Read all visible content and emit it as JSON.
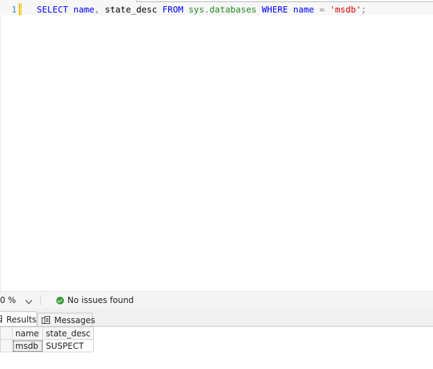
{
  "editor": {
    "line_number": "1",
    "code_tokens": [
      {
        "text": "SELECT",
        "cls": "kw"
      },
      {
        "text": " name",
        "cls": "kw"
      },
      {
        "text": ",",
        "cls": "op"
      },
      {
        "text": " state_desc ",
        "cls": "txt"
      },
      {
        "text": "FROM",
        "cls": "kw"
      },
      {
        "text": " sys",
        "cls": "fn"
      },
      {
        "text": ".",
        "cls": "op"
      },
      {
        "text": "databases",
        "cls": "fn"
      },
      {
        "text": " WHERE",
        "cls": "kw"
      },
      {
        "text": " name",
        "cls": "kw"
      },
      {
        "text": " =",
        "cls": "op"
      },
      {
        "text": " 'msdb'",
        "cls": "str"
      },
      {
        "text": ";",
        "cls": "op"
      }
    ]
  },
  "status_bar": {
    "zoom_value": "0 %",
    "issues_text": "No issues found"
  },
  "results_tabs": {
    "results_label": "Results",
    "messages_label": "Messages"
  },
  "results_grid": {
    "columns": [
      "name",
      "state_desc"
    ],
    "rows": [
      [
        "msdb",
        "SUSPECT"
      ]
    ]
  },
  "colors": {
    "keyword": "#0000ff",
    "function": "#228b22",
    "string": "#e00000",
    "operator": "#808080",
    "line_number": "#2b91af",
    "success_icon": "#3b9c3b"
  },
  "icons": [
    "change-marker",
    "chevron-down-icon",
    "check-circle-icon",
    "grid-results-icon",
    "messages-icon"
  ]
}
